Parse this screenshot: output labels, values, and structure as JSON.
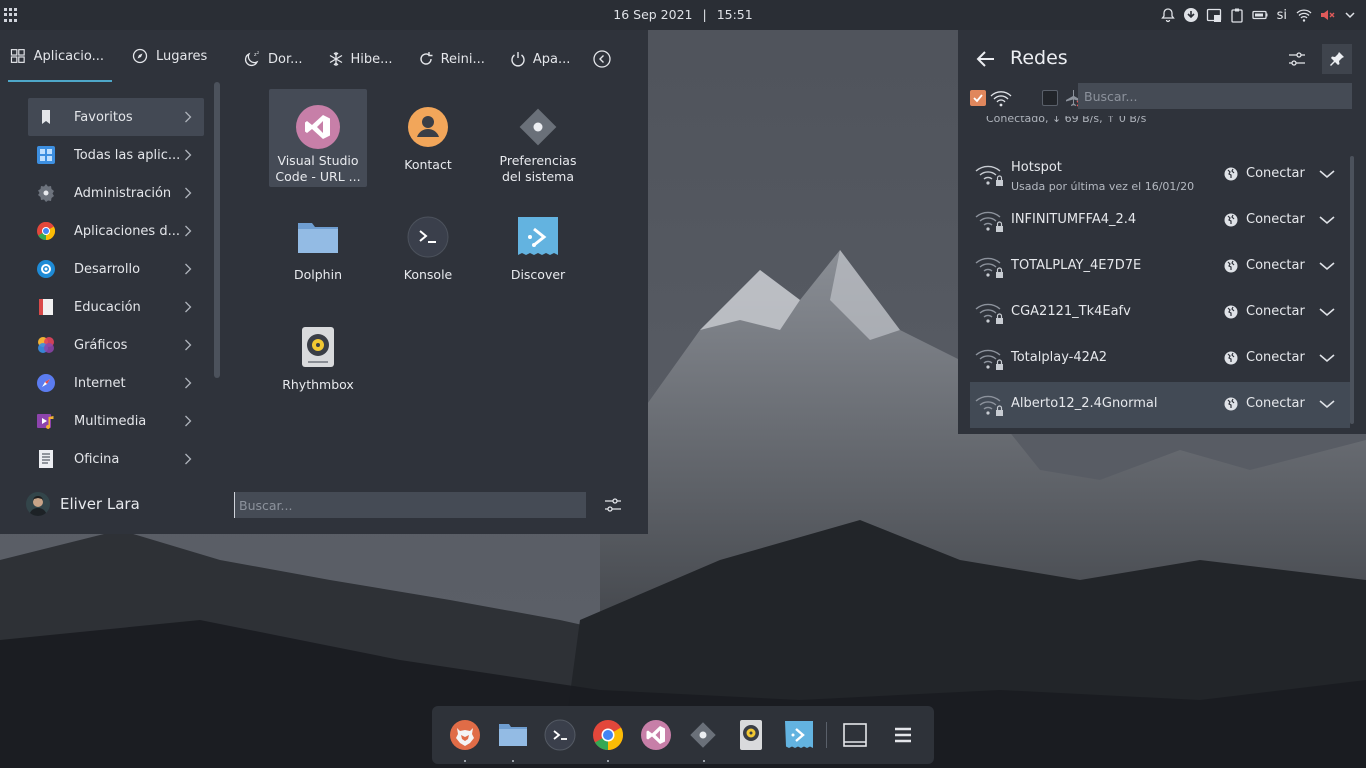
{
  "panel": {
    "date": "16 Sep 2021",
    "separator": "|",
    "time": "15:51",
    "keyboard_layout": "si"
  },
  "launcher": {
    "tabs": [
      {
        "label": "Aplicacio...",
        "icon": "grid-icon"
      },
      {
        "label": "Lugares",
        "icon": "compass-icon"
      }
    ],
    "power": [
      {
        "label": "Dor...",
        "icon": "sleep-icon"
      },
      {
        "label": "Hibe...",
        "icon": "snowflake-icon"
      },
      {
        "label": "Reini...",
        "icon": "restart-icon"
      },
      {
        "label": "Apa...",
        "icon": "power-icon"
      }
    ],
    "categories": [
      {
        "label": "Favoritos",
        "icon": "bookmark-icon"
      },
      {
        "label": "Todas las aplic...",
        "icon": "all-apps-icon"
      },
      {
        "label": "Administración",
        "icon": "admin-gear-icon"
      },
      {
        "label": "Aplicaciones d...",
        "icon": "chrome-icon"
      },
      {
        "label": "Desarrollo",
        "icon": "development-icon"
      },
      {
        "label": "Educación",
        "icon": "education-icon"
      },
      {
        "label": "Gráficos",
        "icon": "graphics-icon"
      },
      {
        "label": "Internet",
        "icon": "internet-icon"
      },
      {
        "label": "Multimedia",
        "icon": "multimedia-icon"
      },
      {
        "label": "Oficina",
        "icon": "office-icon"
      }
    ],
    "apps": [
      {
        "name": "Visual Studio Code - URL ...",
        "icon": "vscode-icon"
      },
      {
        "name": "Kontact",
        "icon": "kontact-icon"
      },
      {
        "name": "Preferencias del sistema",
        "icon": "system-settings-icon"
      },
      {
        "name": "Dolphin",
        "icon": "folder-icon"
      },
      {
        "name": "Konsole",
        "icon": "terminal-icon"
      },
      {
        "name": "Discover",
        "icon": "discover-icon"
      },
      {
        "name": "Rhythmbox",
        "icon": "rhythmbox-icon"
      }
    ],
    "user": "Eliver Lara",
    "search_placeholder": "Buscar..."
  },
  "networks": {
    "title": "Redes",
    "search_placeholder": "Buscar...",
    "connected_status": "Conectado, ↓ 69 B/s, ↑ 0 B/s",
    "connect_label": "Conectar",
    "items": [
      {
        "name": "Hotspot",
        "sub": "Usada por última vez el 16/01/20"
      },
      {
        "name": "INFINITUMFFA4_2.4",
        "sub": ""
      },
      {
        "name": "TOTALPLAY_4E7D7E",
        "sub": ""
      },
      {
        "name": "CGA2121_Tk4Eafv",
        "sub": ""
      },
      {
        "name": "Totalplay-42A2",
        "sub": ""
      },
      {
        "name": "Alberto12_2.4Gnormal",
        "sub": ""
      }
    ]
  },
  "dock": {
    "items": [
      "firefox-icon",
      "folder-icon",
      "terminal-icon",
      "chrome-icon",
      "vscode-icon",
      "system-settings-icon",
      "rhythmbox-icon",
      "discover-icon",
      "show-desktop-icon",
      "menu-icon"
    ]
  },
  "colors": {
    "panel_bg": "#2a2e35",
    "popup_bg": "#2f333b",
    "highlight": "#434954",
    "accent": "#4ea7c9",
    "checkbox": "#e0875d"
  }
}
